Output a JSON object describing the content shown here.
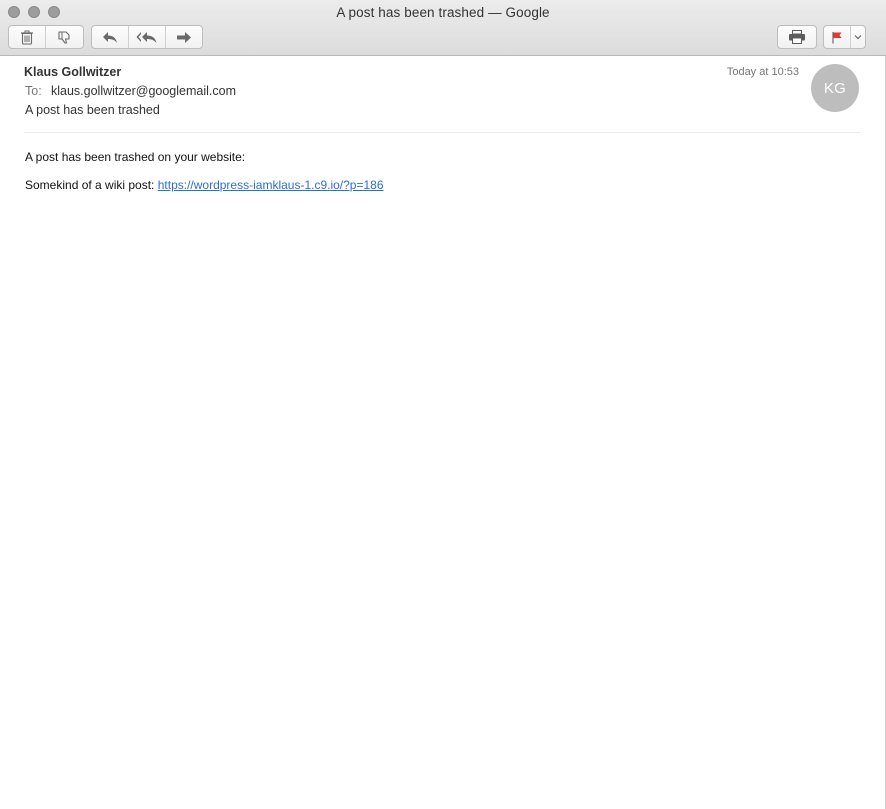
{
  "window": {
    "title": "A post has been trashed — Google"
  },
  "toolbar": {
    "trash_icon": "trash-icon",
    "junk_icon": "thumbs-down-icon",
    "reply_icon": "reply-icon",
    "reply_all_icon": "reply-all-icon",
    "forward_icon": "forward-icon",
    "print_icon": "printer-icon",
    "flag_icon": "flag-icon",
    "flag_color": "#e33b2e"
  },
  "message": {
    "sender": "Klaus Gollwitzer",
    "to_label": "To:",
    "to_value": "klaus.gollwitzer@googlemail.com",
    "subject": "A post has been trashed",
    "date": "Today at 10:53",
    "avatar_initials": "KG",
    "avatar_color": "#bdbdbd"
  },
  "body": {
    "line1": "A post has been trashed on your website:",
    "line2_prefix": "Somekind of a wiki post: ",
    "link_text": "https://wordpress-iamklaus-1.c9.io/?p=186",
    "link_color": "#2a6fd6"
  }
}
